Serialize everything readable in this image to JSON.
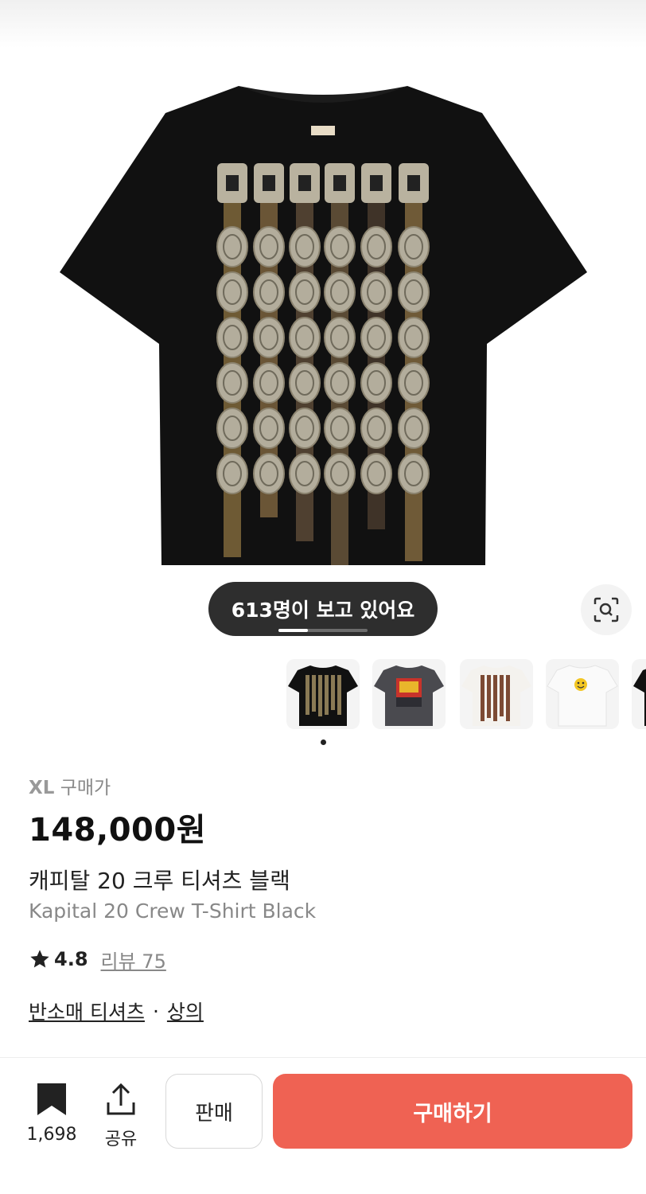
{
  "product": {
    "viewers_text": "613명이 보고 있어요",
    "image_index_progress": 0.33,
    "thumbnails": [
      {
        "name": "black-belt-tee",
        "selected": true
      },
      {
        "name": "gray-graphic-tee",
        "selected": false
      },
      {
        "name": "white-belt-tee",
        "selected": false
      },
      {
        "name": "white-smiley-tee",
        "selected": false
      },
      {
        "name": "partial-tee",
        "selected": false
      }
    ],
    "size_label": "XL",
    "purchase_price_label": "구매가",
    "price": "148,000원",
    "name_ko": "캐피탈 20 크루 티셔츠 블랙",
    "name_en": "Kapital 20 Crew T-Shirt Black",
    "rating": "4.8",
    "review_text": "리뷰 75",
    "category_1": "반소매 티셔츠",
    "category_separator": "·",
    "category_2": "상의"
  },
  "actions": {
    "bookmark_count": "1,698",
    "share_label": "공유",
    "sell_label": "판매",
    "buy_label": "구매하기"
  },
  "colors": {
    "buy_button": "#ef6253",
    "shirt": "#111111",
    "pill": "#2e2e2e"
  },
  "icons": [
    "bookmark-icon",
    "share-icon",
    "lens-search-icon",
    "star-icon"
  ]
}
